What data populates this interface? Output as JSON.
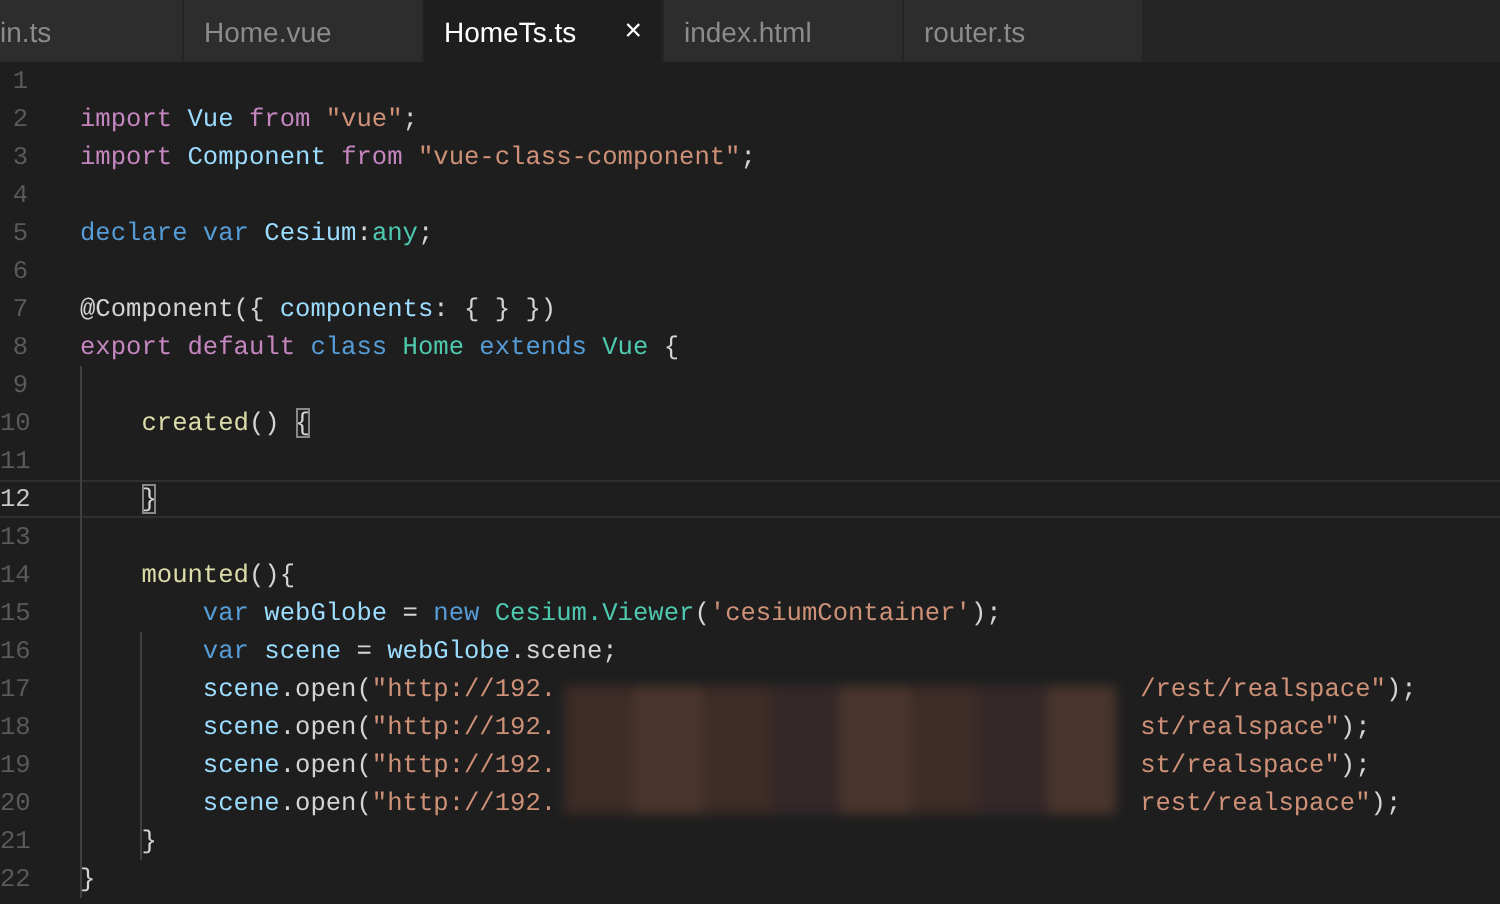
{
  "tabs": [
    {
      "label": "in.ts",
      "selected": false
    },
    {
      "label": "Home.vue",
      "selected": false
    },
    {
      "label": "HomeTs.ts",
      "selected": true,
      "close": "×"
    },
    {
      "label": "index.html",
      "selected": false
    },
    {
      "label": "router.ts",
      "selected": false
    }
  ],
  "editor": {
    "lines": [
      {
        "number": "1",
        "current": false
      },
      {
        "number": "2",
        "current": false,
        "tokens": [
          {
            "text": "import",
            "kind": "keyword"
          },
          {
            "text": " Vue ",
            "kind": "variable"
          },
          {
            "text": "from",
            "kind": "keyword"
          },
          {
            "text": " \"vue\"",
            "kind": "string"
          },
          {
            "text": ";",
            "kind": "plain"
          }
        ]
      },
      {
        "number": "3",
        "current": false,
        "tokens": [
          {
            "text": "import",
            "kind": "keyword"
          },
          {
            "text": " Component ",
            "kind": "variable"
          },
          {
            "text": "from",
            "kind": "keyword"
          },
          {
            "text": " \"vue-class-component\"",
            "kind": "string"
          },
          {
            "text": ";",
            "kind": "plain"
          }
        ]
      },
      {
        "number": "4",
        "current": false
      },
      {
        "number": "5",
        "current": false,
        "tokens": [
          {
            "text": "declare var",
            "kind": "storage"
          },
          {
            "text": " Cesium",
            "kind": "variable"
          },
          {
            "text": ":",
            "kind": "plain"
          },
          {
            "text": "any",
            "kind": "type"
          },
          {
            "text": ";",
            "kind": "plain"
          }
        ]
      },
      {
        "number": "6",
        "current": false
      },
      {
        "number": "7",
        "current": false,
        "tokens": [
          {
            "text": "@Component({ ",
            "kind": "plain"
          },
          {
            "text": "components",
            "kind": "variable"
          },
          {
            "text": ": { } })",
            "kind": "plain"
          }
        ]
      },
      {
        "number": "8",
        "current": false,
        "tokens": [
          {
            "text": "export default",
            "kind": "keyword"
          },
          {
            "text": " class ",
            "kind": "storage"
          },
          {
            "text": "Home",
            "kind": "type"
          },
          {
            "text": " extends ",
            "kind": "storage"
          },
          {
            "text": "Vue",
            "kind": "type"
          },
          {
            "text": " {",
            "kind": "plain"
          }
        ]
      },
      {
        "number": "9",
        "current": false
      },
      {
        "number": "10",
        "current": false,
        "tokens": [
          {
            "text": "    created",
            "kind": "function"
          },
          {
            "text": "() ",
            "kind": "plain"
          },
          {
            "text": "{",
            "kind": "bracket-match"
          }
        ]
      },
      {
        "number": "11",
        "current": false
      },
      {
        "number": "12",
        "current": true,
        "tokens": [
          {
            "text": "    }",
            "kind": "bracket-match"
          }
        ]
      },
      {
        "number": "13",
        "current": false
      },
      {
        "number": "14",
        "current": false,
        "tokens": [
          {
            "text": "    mounted",
            "kind": "function"
          },
          {
            "text": "(){",
            "kind": "plain"
          }
        ]
      },
      {
        "number": "15",
        "current": false,
        "tokens": [
          {
            "text": "        var",
            "kind": "storage"
          },
          {
            "text": " webGlobe ",
            "kind": "variable"
          },
          {
            "text": "= ",
            "kind": "plain"
          },
          {
            "text": "new",
            "kind": "storage"
          },
          {
            "text": " Cesium.Viewer",
            "kind": "type"
          },
          {
            "text": "(",
            "kind": "plain"
          },
          {
            "text": "'cesiumContainer'",
            "kind": "string"
          },
          {
            "text": ");",
            "kind": "plain"
          }
        ]
      },
      {
        "number": "16",
        "current": false,
        "tokens": [
          {
            "text": "        var",
            "kind": "storage"
          },
          {
            "text": " scene ",
            "kind": "variable"
          },
          {
            "text": "= ",
            "kind": "plain"
          },
          {
            "text": "webGlobe",
            "kind": "variable"
          },
          {
            "text": ".scene;",
            "kind": "plain"
          }
        ]
      },
      {
        "number": "17",
        "current": false,
        "tokens": [
          {
            "text": "        scene",
            "kind": "variable"
          },
          {
            "text": ".open(",
            "kind": "plain"
          },
          {
            "text": "\"http://192.",
            "kind": "string"
          },
          {
            "kind": "gap"
          },
          {
            "text": "/rest/realspace\"",
            "kind": "string"
          },
          {
            "text": ");",
            "kind": "plain"
          }
        ]
      },
      {
        "number": "18",
        "current": false,
        "tokens": [
          {
            "text": "        scene",
            "kind": "variable"
          },
          {
            "text": ".open(",
            "kind": "plain"
          },
          {
            "text": "\"http://192.",
            "kind": "string"
          },
          {
            "kind": "gap"
          },
          {
            "text": "st/realspace\"",
            "kind": "string"
          },
          {
            "text": ");",
            "kind": "plain"
          }
        ]
      },
      {
        "number": "19",
        "current": false,
        "tokens": [
          {
            "text": "        scene",
            "kind": "variable"
          },
          {
            "text": ".open(",
            "kind": "plain"
          },
          {
            "text": "\"http://192.",
            "kind": "string"
          },
          {
            "kind": "gap"
          },
          {
            "text": "st/realspace\"",
            "kind": "string"
          },
          {
            "text": ");",
            "kind": "plain"
          }
        ]
      },
      {
        "number": "20",
        "current": false,
        "tokens": [
          {
            "text": "        scene",
            "kind": "variable"
          },
          {
            "text": ".open(",
            "kind": "plain"
          },
          {
            "text": "\"http://192.",
            "kind": "string"
          },
          {
            "kind": "gap"
          },
          {
            "text": "rest/realspace\"",
            "kind": "string"
          },
          {
            "text": ");",
            "kind": "plain"
          }
        ]
      },
      {
        "number": "21",
        "current": false,
        "tokens": [
          {
            "text": "    }",
            "kind": "plain"
          }
        ]
      },
      {
        "number": "22",
        "current": false,
        "tokens": [
          {
            "text": "}",
            "kind": "plain"
          }
        ]
      }
    ]
  }
}
